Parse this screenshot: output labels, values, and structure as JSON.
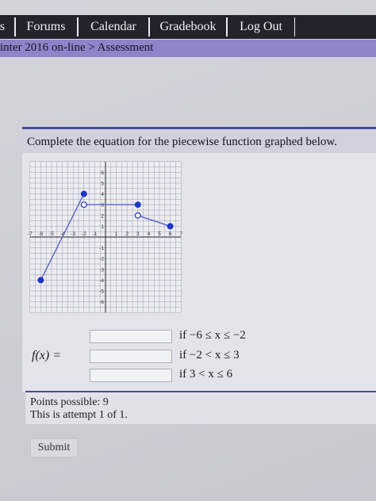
{
  "nav": {
    "partial_left": "s",
    "forums": "Forums",
    "calendar": "Calendar",
    "gradebook": "Gradebook",
    "logout": "Log Out"
  },
  "breadcrumb": "inter 2016 on-line > Assessment",
  "question": {
    "prompt": "Complete the equation for the piecewise function graphed below.",
    "function_label": "f(x) =",
    "pieces": [
      {
        "condition": "if −6 ≤ x ≤ −2",
        "answer": "",
        "brace": "{"
      },
      {
        "condition": "if −2 < x ≤ 3",
        "answer": "",
        "brace": "{"
      },
      {
        "condition": "if 3 < x ≤ 6",
        "answer": "",
        "brace": "{"
      }
    ]
  },
  "graph": {
    "x_ticks": [
      "-7",
      "-6",
      "-5",
      "-4",
      "-3",
      "-2",
      "-1",
      "1",
      "2",
      "3",
      "4",
      "5",
      "6",
      "7"
    ],
    "y_ticks": [
      "6",
      "5",
      "4",
      "3",
      "2",
      "1",
      "-1",
      "-2",
      "-3",
      "-4",
      "-5",
      "-6"
    ],
    "colors": {
      "point": "#1f35c4",
      "line": "#5b63c7",
      "grid": "#9aa0b3",
      "axis": "#222222"
    },
    "segments": [
      {
        "from": [
          -6,
          -4
        ],
        "to": [
          -2,
          4
        ],
        "from_closed": true,
        "to_closed": true
      },
      {
        "from": [
          -2,
          3
        ],
        "to": [
          3,
          3
        ],
        "from_closed": false,
        "to_closed": true
      },
      {
        "from": [
          3,
          2
        ],
        "to": [
          6,
          1
        ],
        "from_closed": false,
        "to_closed": true
      }
    ]
  },
  "status": {
    "points": "Points possible: 9",
    "attempt": "This is attempt 1 of 1."
  },
  "submit_label": "Submit"
}
